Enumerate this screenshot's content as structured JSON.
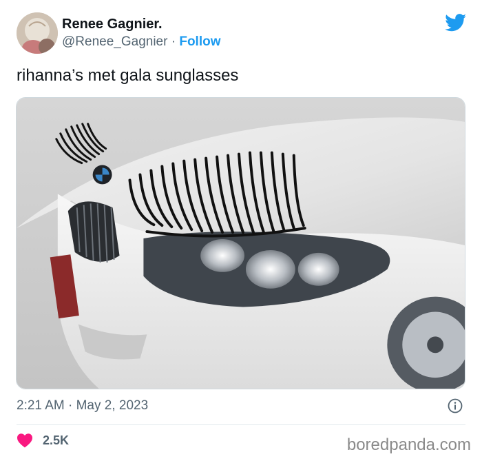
{
  "author": {
    "name": "Renee Gagnier.",
    "handle": "@Renee_Gagnier",
    "separator": " · ",
    "follow_label": "Follow"
  },
  "icons": {
    "brand": "twitter-bird-icon",
    "info": "info-icon",
    "like": "heart-icon"
  },
  "tweet": {
    "text": "rihanna’s met gala sunglasses",
    "timestamp": "2:21 AM · May 2, 2023",
    "like_count": "2.5K"
  },
  "watermark": "boredpanda.com",
  "colors": {
    "accent": "#1d9bf0",
    "like": "#f91880",
    "secondary_text": "#536471"
  }
}
